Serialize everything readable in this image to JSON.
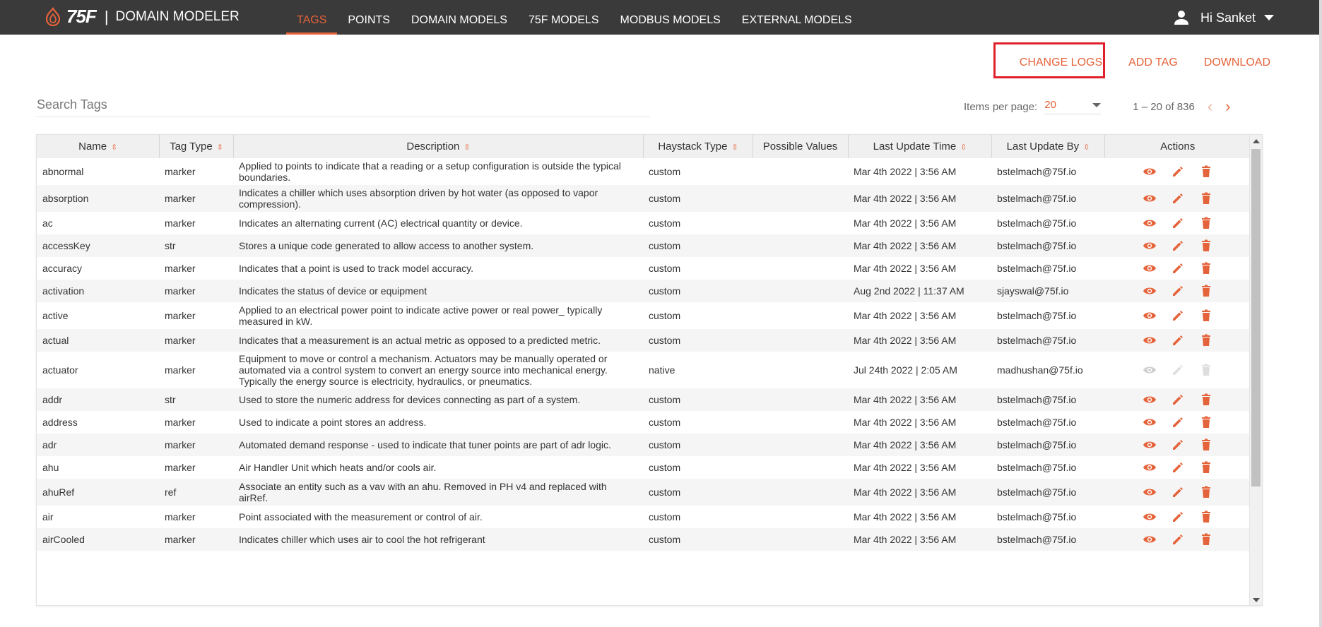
{
  "brand": {
    "logo_text": "75F",
    "separator": "|",
    "app_name": "DOMAIN MODELER",
    "accent": "#e5633a"
  },
  "nav": {
    "items": [
      {
        "label": "TAGS",
        "active": true
      },
      {
        "label": "POINTS"
      },
      {
        "label": "DOMAIN MODELS"
      },
      {
        "label": "75F MODELS"
      },
      {
        "label": "MODBUS MODELS"
      },
      {
        "label": "EXTERNAL MODELS"
      }
    ]
  },
  "user": {
    "greeting": "Hi Sanket",
    "icon": "user-icon"
  },
  "actions": {
    "change_logs": "CHANGE LOGS",
    "add_tag": "ADD TAG",
    "download": "DOWNLOAD"
  },
  "search": {
    "placeholder": "Search Tags",
    "value": ""
  },
  "pagination": {
    "items_per_page_label": "Items per page:",
    "items_per_page": "20",
    "range": "1 – 20 of 836"
  },
  "table": {
    "columns": [
      "Name",
      "Tag Type",
      "Description",
      "Haystack Type",
      "Possible Values",
      "Last Update Time",
      "Last Update By",
      "Actions"
    ],
    "rows": [
      {
        "name": "abnormal",
        "type": "marker",
        "description": "Applied to points to indicate that a reading or a setup configuration is outside the typical boundaries.",
        "haystack": "custom",
        "possible": "",
        "time": "Mar 4th 2022 | 3:56 AM",
        "by": "bstelmach@75f.io",
        "editable": true
      },
      {
        "name": "absorption",
        "type": "marker",
        "description": "Indicates a chiller which uses absorption driven by hot water (as opposed to vapor compression).",
        "haystack": "custom",
        "possible": "",
        "time": "Mar 4th 2022 | 3:56 AM",
        "by": "bstelmach@75f.io",
        "editable": true
      },
      {
        "name": "ac",
        "type": "marker",
        "description": "Indicates an alternating current (AC) electrical quantity or device.",
        "haystack": "custom",
        "possible": "",
        "time": "Mar 4th 2022 | 3:56 AM",
        "by": "bstelmach@75f.io",
        "editable": true
      },
      {
        "name": "accessKey",
        "type": "str",
        "description": "Stores a unique code generated to allow access to another system.",
        "haystack": "custom",
        "possible": "",
        "time": "Mar 4th 2022 | 3:56 AM",
        "by": "bstelmach@75f.io",
        "editable": true
      },
      {
        "name": "accuracy",
        "type": "marker",
        "description": "Indicates that a point is used to track model accuracy.",
        "haystack": "custom",
        "possible": "",
        "time": "Mar 4th 2022 | 3:56 AM",
        "by": "bstelmach@75f.io",
        "editable": true
      },
      {
        "name": "activation",
        "type": "marker",
        "description": "Indicates the status of device or equipment",
        "haystack": "custom",
        "possible": "",
        "time": "Aug 2nd 2022 | 11:37 AM",
        "by": "sjayswal@75f.io",
        "editable": true
      },
      {
        "name": "active",
        "type": "marker",
        "description": "Applied to an electrical power point to indicate active power or real power_ typically measured in kW.",
        "haystack": "custom",
        "possible": "",
        "time": "Mar 4th 2022 | 3:56 AM",
        "by": "bstelmach@75f.io",
        "editable": true
      },
      {
        "name": "actual",
        "type": "marker",
        "description": "Indicates that a measurement is an actual metric as opposed to a predicted metric.",
        "haystack": "custom",
        "possible": "",
        "time": "Mar 4th 2022 | 3:56 AM",
        "by": "bstelmach@75f.io",
        "editable": true
      },
      {
        "name": "actuator",
        "type": "marker",
        "description": "Equipment to move or control a mechanism. Actuators may be manually operated or automated via a control system to convert an energy source into mechanical energy. Typically the energy source is electricity, hydraulics, or pneumatics.",
        "haystack": "native",
        "possible": "",
        "time": "Jul 24th 2022 | 2:05 AM",
        "by": "madhushan@75f.io",
        "editable": false
      },
      {
        "name": "addr",
        "type": "str",
        "description": "Used to store the numeric address for devices connecting as part of a system.",
        "haystack": "custom",
        "possible": "",
        "time": "Mar 4th 2022 | 3:56 AM",
        "by": "bstelmach@75f.io",
        "editable": true
      },
      {
        "name": "address",
        "type": "marker",
        "description": "Used to indicate a point stores an address.",
        "haystack": "custom",
        "possible": "",
        "time": "Mar 4th 2022 | 3:56 AM",
        "by": "bstelmach@75f.io",
        "editable": true
      },
      {
        "name": "adr",
        "type": "marker",
        "description": "Automated demand response - used to indicate that tuner points are part of adr logic.",
        "haystack": "custom",
        "possible": "",
        "time": "Mar 4th 2022 | 3:56 AM",
        "by": "bstelmach@75f.io",
        "editable": true
      },
      {
        "name": "ahu",
        "type": "marker",
        "description": "Air Handler Unit which heats and/or cools air.",
        "haystack": "custom",
        "possible": "",
        "time": "Mar 4th 2022 | 3:56 AM",
        "by": "bstelmach@75f.io",
        "editable": true
      },
      {
        "name": "ahuRef",
        "type": "ref",
        "description": "Associate an entity such as a vav with an ahu. Removed in PH v4 and replaced with airRef.",
        "haystack": "custom",
        "possible": "",
        "time": "Mar 4th 2022 | 3:56 AM",
        "by": "bstelmach@75f.io",
        "editable": true
      },
      {
        "name": "air",
        "type": "marker",
        "description": "Point associated with the measurement or control of air.",
        "haystack": "custom",
        "possible": "",
        "time": "Mar 4th 2022 | 3:56 AM",
        "by": "bstelmach@75f.io",
        "editable": true
      },
      {
        "name": "airCooled",
        "type": "marker",
        "description": "Indicates chiller which uses air to cool the hot refrigerant",
        "haystack": "custom",
        "possible": "",
        "time": "Mar 4th 2022 | 3:56 AM",
        "by": "bstelmach@75f.io",
        "editable": true
      }
    ]
  }
}
